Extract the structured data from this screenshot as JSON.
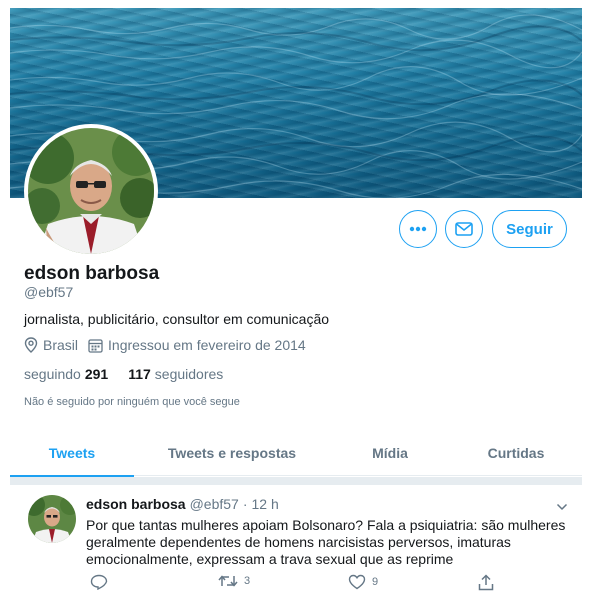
{
  "profile": {
    "name": "edson barbosa",
    "handle": "@ebf57",
    "bio": "jornalista, publicitário, consultor em comunicação",
    "location": "Brasil",
    "joined": "Ingressou em fevereiro de 2014",
    "following_label": "seguindo",
    "following_count": "291",
    "followers_count": "117",
    "followers_label": "seguidores",
    "not_followed_note": "Não é seguido por ninguém que você segue"
  },
  "actions": {
    "follow_label": "Seguir",
    "more_icon": "more-icon",
    "message_icon": "envelope-icon"
  },
  "tabs": [
    {
      "label": "Tweets",
      "active": true
    },
    {
      "label": "Tweets e respostas",
      "active": false
    },
    {
      "label": "Mídia",
      "active": false
    },
    {
      "label": "Curtidas",
      "active": false
    }
  ],
  "tweet": {
    "name": "edson barbosa",
    "handle": "@ebf57",
    "dot": "·",
    "time": "12 h",
    "text": "Por que tantas mulheres apoiam Bolsonaro? Fala a psiquiatria: são mulheres geralmente dependentes de homens narcisistas perversos, imaturas emocionalmente, expressam a trava sexual que as reprime",
    "replies": "",
    "retweets": "3",
    "likes": "9"
  },
  "colors": {
    "accent": "#1da1f2",
    "muted": "#657786",
    "text": "#14171a"
  }
}
